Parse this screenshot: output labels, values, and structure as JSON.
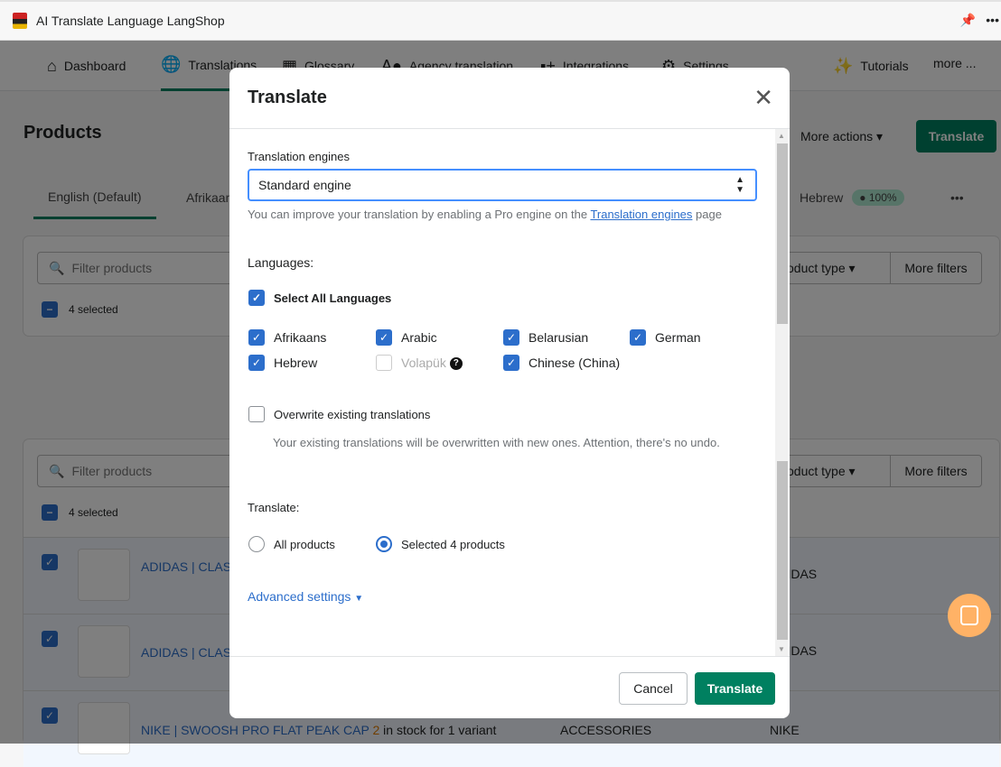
{
  "window": {
    "title": "AI Translate Language LangShop",
    "pin_icon": "pin-icon",
    "menu_icon": "more-dots-icon"
  },
  "nav": {
    "items": [
      {
        "label": "Dashboard",
        "icon": "home-icon"
      },
      {
        "label": "Translations",
        "icon": "globe-icon"
      },
      {
        "label": "Glossary",
        "icon": "book-icon"
      },
      {
        "label": "Agency translation",
        "icon": "agency-icon"
      },
      {
        "label": "Integrations",
        "icon": "integrations-icon"
      },
      {
        "label": "Settings",
        "icon": "gear-icon"
      },
      {
        "label": "Tutorials",
        "icon": "magic-wand-icon"
      }
    ],
    "more": "more ..."
  },
  "page": {
    "title": "Products",
    "more_actions": "More actions",
    "translate": "Translate"
  },
  "lang_tabs": {
    "items": [
      "English (Default)",
      "Afrikaans",
      "Hebrew"
    ],
    "hebrew_badge": "100%",
    "more": "•••"
  },
  "filters": {
    "placeholder": "Filter products",
    "product_type": "Product type",
    "more_filters": "More filters",
    "selected": "4 selected"
  },
  "rows": [
    {
      "name": "ADIDAS | CLASSIC BACKPACK | LEGEND INK MULTICOLOUR",
      "type": "",
      "vendor": "ADIDAS"
    },
    {
      "name": "ADIDAS | CLASSIC BACKPACK",
      "type": "",
      "vendor": "ADIDAS"
    },
    {
      "name": "NIKE | SWOOSH PRO FLAT PEAK CAP",
      "stock": "2",
      "stock_text": "in stock for 1 variant",
      "type": "ACCESSORIES",
      "vendor": "NIKE"
    }
  ],
  "modal": {
    "title": "Translate",
    "engines_label": "Translation engines",
    "engine_value": "Standard engine",
    "hint_pre": "You can improve your translation by enabling a Pro engine on the ",
    "hint_link": "Translation engines",
    "hint_post": " page",
    "languages_label": "Languages:",
    "select_all": "Select All Languages",
    "languages": [
      {
        "name": "Afrikaans",
        "checked": true
      },
      {
        "name": "Arabic",
        "checked": true
      },
      {
        "name": "Belarusian",
        "checked": true
      },
      {
        "name": "German",
        "checked": true
      },
      {
        "name": "Hebrew",
        "checked": true
      },
      {
        "name": "Volapük",
        "checked": false,
        "disabled": true
      },
      {
        "name": "Chinese (China)",
        "checked": true
      }
    ],
    "overwrite_label": "Overwrite existing translations",
    "overwrite_hint": "Your existing translations will be overwritten with new ones. Attention, there's no undo.",
    "translate_label": "Translate:",
    "scope_all": "All products",
    "scope_selected": "Selected 4 products",
    "scope_value": "selected",
    "advanced": "Advanced settings",
    "cancel": "Cancel",
    "submit": "Translate"
  },
  "colors": {
    "primary": "#008060",
    "link": "#2c6ecb",
    "chat": "#ffb266"
  }
}
